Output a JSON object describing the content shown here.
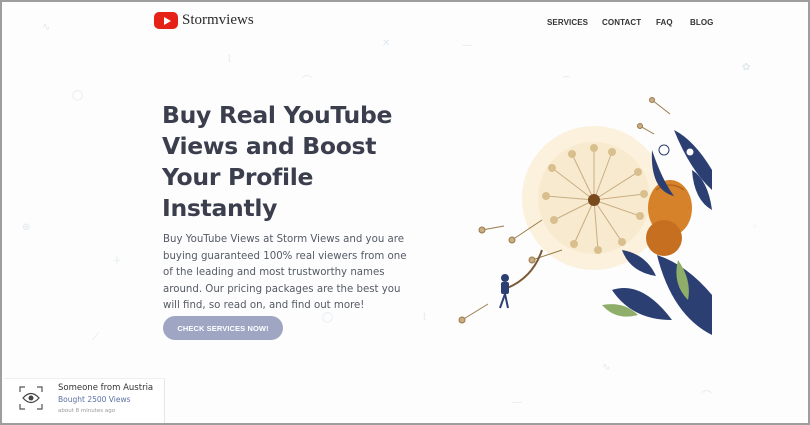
{
  "header": {
    "logo_text": "Stormviews",
    "nav": [
      "SERVICES",
      "CONTACT",
      "FAQ",
      "BLOG"
    ]
  },
  "hero": {
    "headline": "Buy Real YouTube Views and Boost Your Profile Instantly",
    "subtext": "Buy YouTube Views at Storm Views and you are buying guaranteed 100% real viewers from one of the leading and most trustworthy names around. Our pricing packages are the best you will find, so read on, and find out more!",
    "cta_label": "CHECK SERVICES NOW!"
  },
  "notification": {
    "title": "Someone from Austria",
    "subtitle": "Bought 2500 Views",
    "time": "about 8 minutes ago"
  },
  "colors": {
    "brand_red": "#e62117",
    "cta": "#9ea6c4",
    "headline": "#3a3e4d",
    "accent_navy": "#2c3f73",
    "accent_orange": "#d6822b"
  }
}
